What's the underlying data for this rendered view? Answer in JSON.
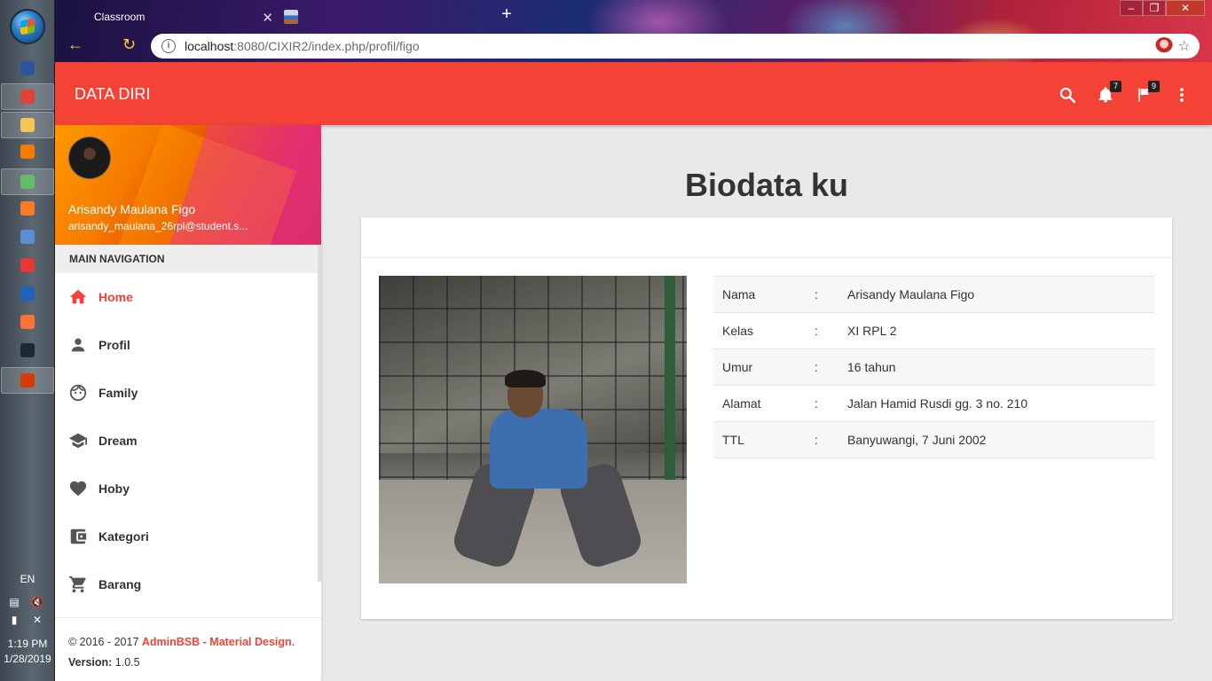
{
  "taskbar": {
    "language": "EN",
    "time": "1:19 PM",
    "date": "1/28/2019",
    "apps": [
      {
        "name": "word-icon",
        "color": "#2b579a"
      },
      {
        "name": "chrome-icon",
        "color": "#db4437"
      },
      {
        "name": "file-explorer-icon",
        "color": "#f6c453"
      },
      {
        "name": "media-player-icon",
        "color": "#f57c00"
      },
      {
        "name": "atom-icon",
        "color": "#66bb6a"
      },
      {
        "name": "xampp-icon",
        "color": "#fb7a24"
      },
      {
        "name": "virtualbox-icon",
        "color": "#5b8fd4"
      },
      {
        "name": "git-icon",
        "color": "#e53935"
      },
      {
        "name": "filezilla-icon",
        "color": "#1e63b8"
      },
      {
        "name": "firefox-icon",
        "color": "#ff7139"
      },
      {
        "name": "steam-icon",
        "color": "#1b2838"
      },
      {
        "name": "office-icon",
        "color": "#d83b01"
      }
    ]
  },
  "browser": {
    "tabs": [
      {
        "title": "Classroom"
      },
      {
        "title": ""
      }
    ],
    "url_host": "localhost",
    "url_rest": ":8080/CIXIR2/index.php/profil/figo"
  },
  "navbar": {
    "title": "DATA DIRI",
    "notification_count": "7",
    "flag_count": "9",
    "color": "#f44336"
  },
  "sidebar": {
    "user_name": "Arisandy Maulana Figo",
    "user_email": "arisandy_maulana_26rpl@student.s...",
    "menu_header": "MAIN NAVIGATION",
    "items": [
      {
        "label": "Home",
        "icon": "home-icon",
        "active": true
      },
      {
        "label": "Profil",
        "icon": "person-icon",
        "active": false
      },
      {
        "label": "Family",
        "icon": "face-icon",
        "active": false
      },
      {
        "label": "Dream",
        "icon": "school-icon",
        "active": false
      },
      {
        "label": "Hoby",
        "icon": "heart-icon",
        "active": false
      },
      {
        "label": "Kategori",
        "icon": "wallet-icon",
        "active": false
      },
      {
        "label": "Barang",
        "icon": "cart-icon",
        "active": false
      }
    ],
    "legal": {
      "copyright": "© 2016 - 2017 ",
      "brand": "AdminBSB - Material Design",
      "period": ".",
      "version_label": "Version:",
      "version": " 1.0.5"
    }
  },
  "content": {
    "title": "Biodata ku",
    "bio": [
      {
        "key": "Nama",
        "sep": ":",
        "value": "Arisandy Maulana Figo"
      },
      {
        "key": "Kelas",
        "sep": ":",
        "value": "XI RPL 2"
      },
      {
        "key": "Umur",
        "sep": ":",
        "value": "16 tahun"
      },
      {
        "key": "Alamat",
        "sep": ":",
        "value": "Jalan Hamid Rusdi gg. 3 no. 210"
      },
      {
        "key": "TTL",
        "sep": ":",
        "value": "Banyuwangi, 7 Juni 2002"
      }
    ]
  }
}
